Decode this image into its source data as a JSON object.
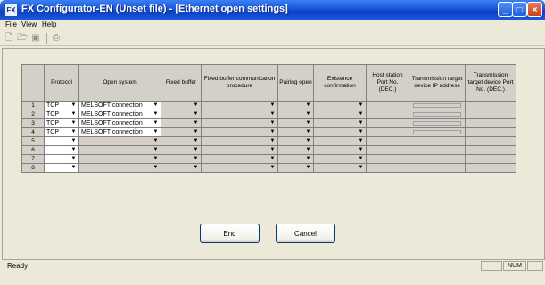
{
  "window": {
    "title": "FX Configurator-EN (Unset file) - [Ethernet open settings]",
    "icon": "app-icon"
  },
  "menu": [
    {
      "label": "File",
      "mnemonic": "F"
    },
    {
      "label": "View",
      "mnemonic": "V"
    },
    {
      "label": "Help",
      "mnemonic": "H"
    }
  ],
  "toolbar": [
    "new-file-icon",
    "open-folder-icon",
    "save-icon",
    "print-icon"
  ],
  "table": {
    "headers": {
      "row": "",
      "protocol": "Protocol",
      "open_system": "Open system",
      "fixed_buffer": "Fixed buffer",
      "fixed_buffer_proc": "Fixed buffer communication procedure",
      "pairing_open": "Pairing open",
      "existence": "Existence confirmation",
      "host_port": "Host station Port No. (DEC.)",
      "target_ip": "Transmission target device IP address",
      "target_port": "Transmission target device Port No. (DEC.)"
    },
    "rows": [
      {
        "num": "1",
        "protocol": "TCP",
        "open_system": "MELSOFT connection"
      },
      {
        "num": "2",
        "protocol": "TCP",
        "open_system": "MELSOFT connection"
      },
      {
        "num": "3",
        "protocol": "TCP",
        "open_system": "MELSOFT connection"
      },
      {
        "num": "4",
        "protocol": "TCP",
        "open_system": "MELSOFT connection"
      },
      {
        "num": "5",
        "protocol": "",
        "open_system": ""
      },
      {
        "num": "6",
        "protocol": "",
        "open_system": ""
      },
      {
        "num": "7",
        "protocol": "",
        "open_system": ""
      },
      {
        "num": "8",
        "protocol": "",
        "open_system": ""
      }
    ]
  },
  "buttons": {
    "end": "End",
    "cancel": "Cancel"
  },
  "status": {
    "text": "Ready",
    "num": "NUM"
  }
}
